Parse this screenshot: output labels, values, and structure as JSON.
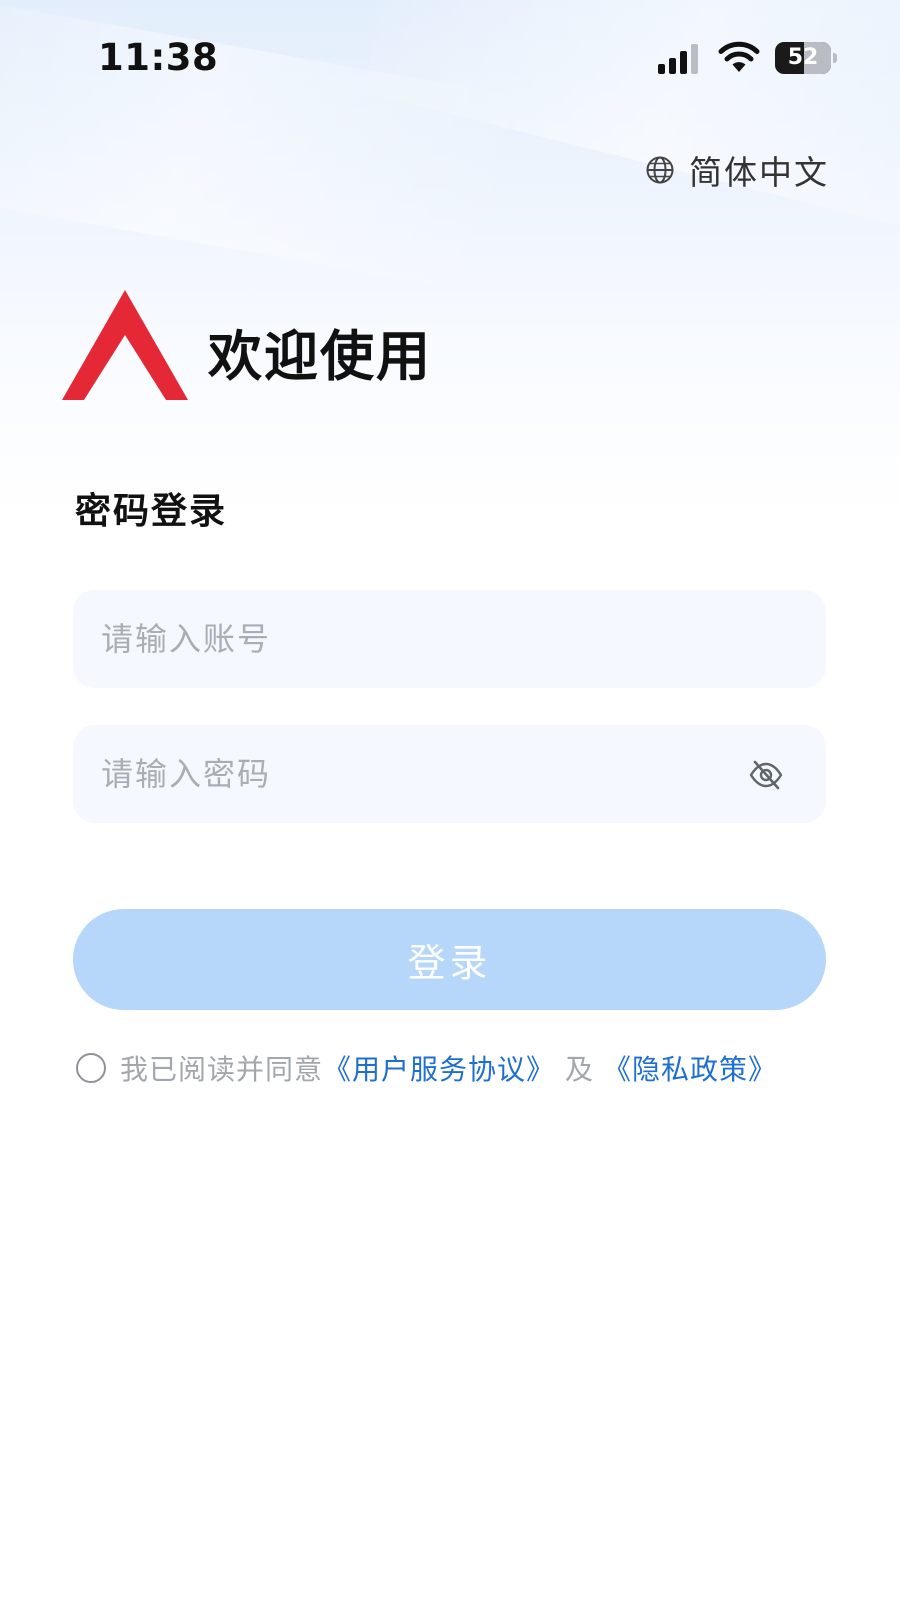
{
  "status_bar": {
    "time": "11:38",
    "battery_level": "52"
  },
  "language": {
    "label": "简体中文",
    "icon": "globe-icon"
  },
  "header": {
    "logo": "brand-logo",
    "welcome_title": "欢迎使用"
  },
  "login_form": {
    "section_title": "密码登录",
    "account_field": {
      "placeholder": "请输入账号",
      "value": ""
    },
    "password_field": {
      "placeholder": "请输入密码",
      "value": "",
      "toggle_icon": "eye-off-icon"
    },
    "submit_label": "登录"
  },
  "agreement": {
    "checked": false,
    "text": "我已阅读并同意",
    "terms_link": "《用户服务协议》",
    "connector": "及",
    "privacy_link": "《隐私政策》"
  },
  "colors": {
    "brand_red": "#e52835",
    "button_disabled": "#b6d7f9",
    "link_blue": "#1f6fd1"
  }
}
